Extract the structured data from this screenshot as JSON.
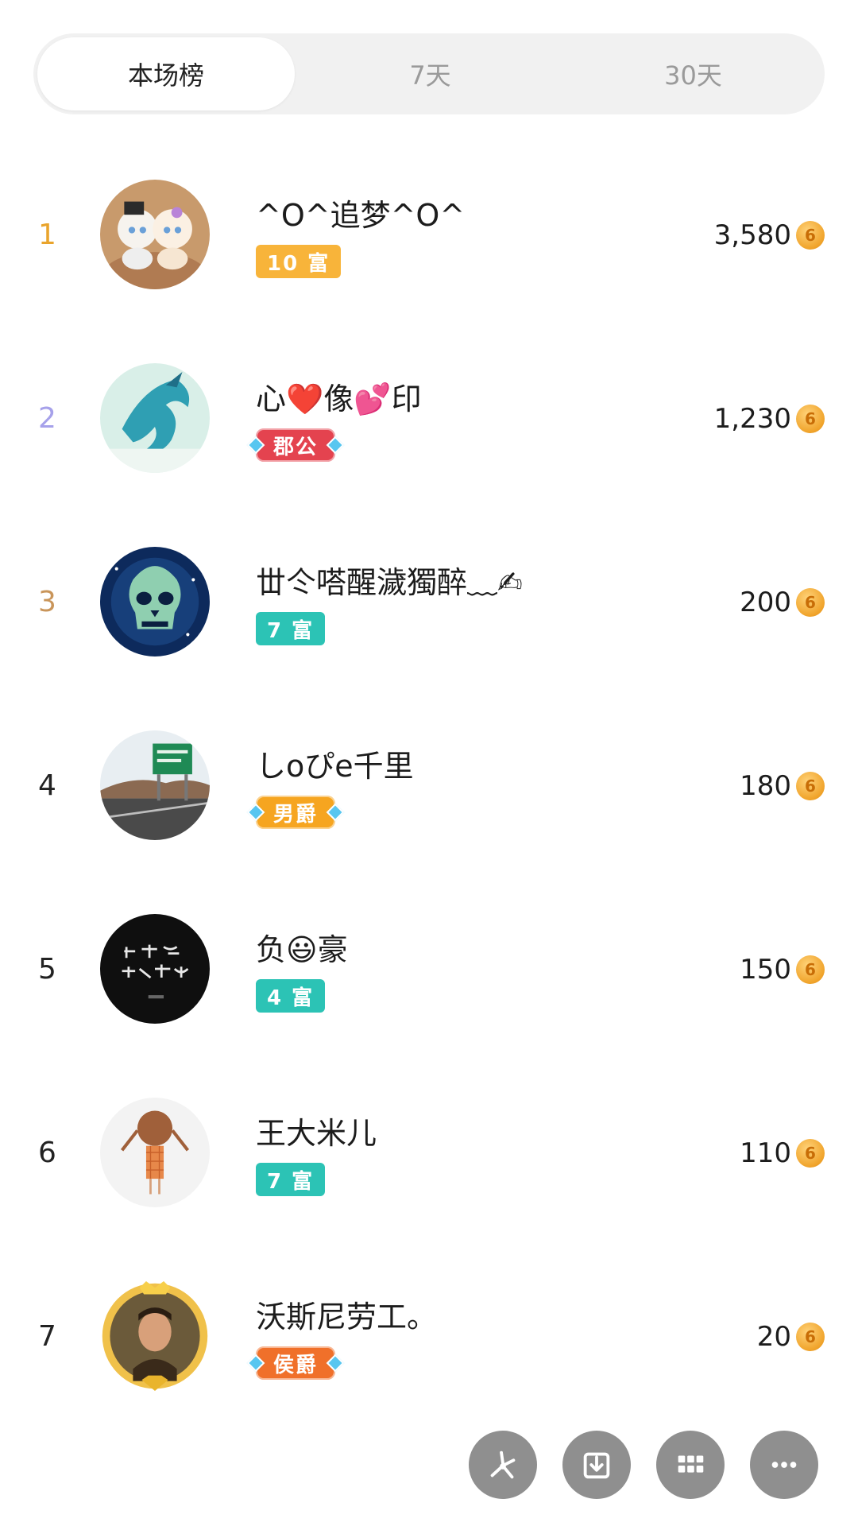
{
  "tabs": [
    {
      "label": "本场榜",
      "active": true
    },
    {
      "label": "7天",
      "active": false
    },
    {
      "label": "30天",
      "active": false
    }
  ],
  "rank_colors": {
    "1": "#e9a42c",
    "2": "#a6a1ea",
    "3": "#c9955a",
    "default": "#222222"
  },
  "entries": [
    {
      "rank": "1",
      "name": "^O^追梦^O^",
      "badge": "10 富",
      "badge_type": "wealth",
      "badge_color": "#f8b43a",
      "score": "3,580",
      "avatar_icon": "cat-dolls-avatar"
    },
    {
      "rank": "2",
      "name": "心❤️像💕印",
      "badge": "郡公",
      "badge_type": "title",
      "badge_color": "#e4434f",
      "score": "1,230",
      "avatar_icon": "dragon-avatar"
    },
    {
      "rank": "3",
      "name": "丗仒嗒醒濊獨醉﹏✍",
      "badge": "7 富",
      "badge_type": "wealth",
      "badge_color": "#2cc3b5",
      "score": "200",
      "avatar_icon": "skull-avatar"
    },
    {
      "rank": "4",
      "name": "しoぴe千里",
      "badge": "男爵",
      "badge_type": "title",
      "badge_color": "#f6a520",
      "score": "180",
      "avatar_icon": "highway-sign-avatar"
    },
    {
      "rank": "5",
      "name": "负😃豪",
      "badge": "4 富",
      "badge_type": "wealth",
      "badge_color": "#2cc3b5",
      "score": "150",
      "avatar_icon": "calligraphy-avatar"
    },
    {
      "rank": "6",
      "name": "王大米儿",
      "badge": "7 富",
      "badge_type": "wealth",
      "badge_color": "#2cc3b5",
      "score": "110",
      "avatar_icon": "cartoon-girl-avatar"
    },
    {
      "rank": "7",
      "name": "沃斯尼劳工。",
      "badge": "侯爵",
      "badge_type": "title",
      "badge_color": "#f0702a",
      "score": "20",
      "avatar_icon": "portrait-crown-frame-avatar"
    }
  ],
  "coin_glyph": "6",
  "fab_buttons": [
    "share-icon",
    "download-icon",
    "grid-icon",
    "more-icon"
  ]
}
